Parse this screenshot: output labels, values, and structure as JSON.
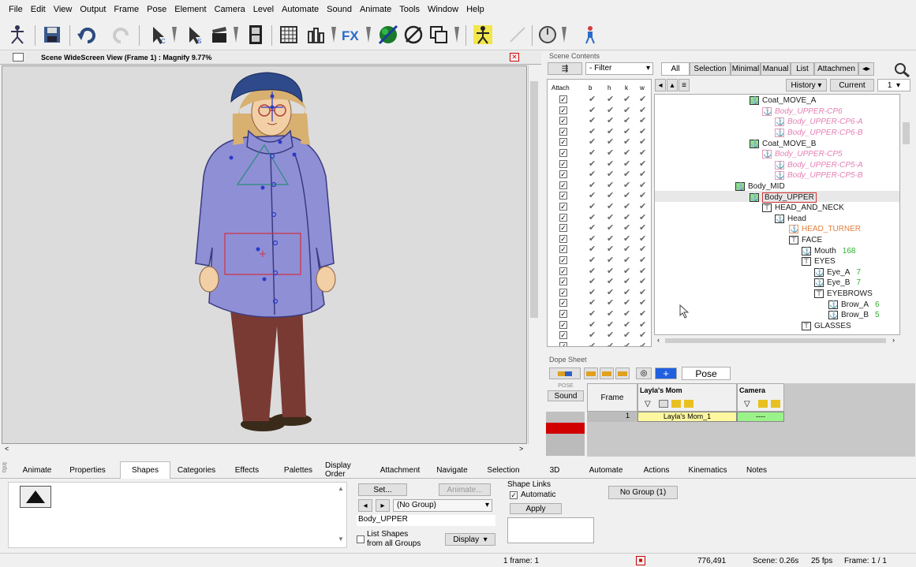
{
  "menu": [
    "File",
    "Edit",
    "View",
    "Output",
    "Frame",
    "Pose",
    "Element",
    "Camera",
    "Level",
    "Automate",
    "Sound",
    "Animate",
    "Tools",
    "Window",
    "Help"
  ],
  "toolbar": {
    "icons": [
      "skeleton-icon",
      "save-icon",
      "undo-icon",
      "redo-icon",
      "select-element-icon",
      "select-group-icon",
      "scene-clap-icon",
      "film-icon",
      "grid-icon",
      "bars-icon",
      "fx-icon",
      "sphere-icon",
      "no-element-icon",
      "layers-icon",
      "posable-icon",
      "line-icon",
      "camera-dial-icon",
      "walk-icon"
    ]
  },
  "scene": {
    "title": "Scene WideScreen View (Frame 1) : Magnify 9.77%"
  },
  "scene_contents": {
    "header": "Scene Contents",
    "filter_placeholder": "- Filter",
    "tabs": [
      "All",
      "Selection",
      "Minimal",
      "Manual",
      "List",
      "Attachmen"
    ],
    "history_label": "History",
    "current_label": "Current",
    "current_value": "1",
    "col_headers": [
      "Attach",
      "b",
      "h",
      "k",
      "w"
    ],
    "tree": [
      {
        "label": "Coat_MOVE_A",
        "indent": 120,
        "color": "#1a1a1a",
        "kind": "anchor-green"
      },
      {
        "label": "Body_UPPER-CP6",
        "indent": 136,
        "color": "#e47fb3",
        "kind": "pink"
      },
      {
        "label": "Body_UPPER-CP6-A",
        "indent": 152,
        "color": "#e47fb3",
        "kind": "pink"
      },
      {
        "label": "Body_UPPER-CP6-B",
        "indent": 152,
        "color": "#e47fb3",
        "kind": "pink"
      },
      {
        "label": "Coat_MOVE_B",
        "indent": 120,
        "color": "#1a1a1a",
        "kind": "anchor-green"
      },
      {
        "label": "Body_UPPER-CP5",
        "indent": 136,
        "color": "#e47fb3",
        "kind": "pink"
      },
      {
        "label": "Body_UPPER-CP5-A",
        "indent": 152,
        "color": "#e47fb3",
        "kind": "pink"
      },
      {
        "label": "Body_UPPER-CP5-B",
        "indent": 152,
        "color": "#e47fb3",
        "kind": "pink"
      },
      {
        "label": "Body_MID",
        "indent": 102,
        "color": "#1a1a1a",
        "kind": "anchor-green"
      },
      {
        "label": "Body_UPPER",
        "indent": 120,
        "color": "#1a1a1a",
        "kind": "anchor-green-sel"
      },
      {
        "label": "HEAD_AND_NECK",
        "indent": 136,
        "color": "#1a1a1a",
        "kind": "plain"
      },
      {
        "label": "Head",
        "indent": 152,
        "color": "#1a1a1a",
        "kind": "anchor"
      },
      {
        "label": "HEAD_TURNER",
        "indent": 170,
        "color": "#e08040",
        "kind": "orange"
      },
      {
        "label": "FACE",
        "indent": 170,
        "color": "#1a1a1a",
        "kind": "plain"
      },
      {
        "label": "Mouth",
        "indent": 186,
        "color": "#1a1a1a",
        "kind": "anchor",
        "num": "168"
      },
      {
        "label": "EYES",
        "indent": 186,
        "color": "#1a1a1a",
        "kind": "plain"
      },
      {
        "label": "Eye_A",
        "indent": 202,
        "color": "#1a1a1a",
        "kind": "anchor",
        "num": "7"
      },
      {
        "label": "Eye_B",
        "indent": 202,
        "color": "#1a1a1a",
        "kind": "anchor",
        "num": "7"
      },
      {
        "label": "EYEBROWS",
        "indent": 202,
        "color": "#1a1a1a",
        "kind": "plain"
      },
      {
        "label": "Brow_A",
        "indent": 220,
        "color": "#1a1a1a",
        "kind": "anchor",
        "num": "6"
      },
      {
        "label": "Brow_B",
        "indent": 220,
        "color": "#1a1a1a",
        "kind": "anchor",
        "num": "5"
      },
      {
        "label": "GLASSES",
        "indent": 186,
        "color": "#1a1a1a",
        "kind": "plain"
      }
    ]
  },
  "dope_sheet": {
    "header": "Dope Sheet",
    "pose_button": "Pose",
    "pose_label": "POSE",
    "sound_label": "Sound",
    "frame_col": "Frame",
    "col1": "Layla's Mom",
    "col2": "Camera",
    "frame_value": "1",
    "cell1": "Layla's Mom_1",
    "cell2": "----"
  },
  "bottom_tabs": [
    "Animate",
    "Properties",
    "Shapes",
    "Categories",
    "Effects",
    "Palettes",
    "Display Order",
    "Attachment",
    "Navigate",
    "Selection",
    "3D",
    "Automate",
    "Actions",
    "Kinematics",
    "Notes"
  ],
  "active_tab": "Shapes",
  "shapes": {
    "set_label": "Set...",
    "animate_label": "Animate...",
    "group_select": "(No Group)",
    "shape_name": "Body_UPPER",
    "list_shapes_label_1": "List Shapes",
    "list_shapes_label_2": "from all Groups",
    "display_label": "Display",
    "shape_links_label": "Shape Links",
    "automatic_label": "Automatic",
    "apply_label": "Apply",
    "no_group_label": "No Group (1)"
  },
  "status": {
    "frames": "1 frame: 1",
    "coords": "776,491",
    "scene_time": "Scene: 0.26s",
    "fps": "25 fps",
    "frame": "Frame:  1 / 1"
  },
  "colors": {
    "coat": "#8f8fd6",
    "pants": "#7a3a34",
    "hat": "#2f4a8a",
    "hair": "#d8b070",
    "skin": "#f3cfa6"
  }
}
